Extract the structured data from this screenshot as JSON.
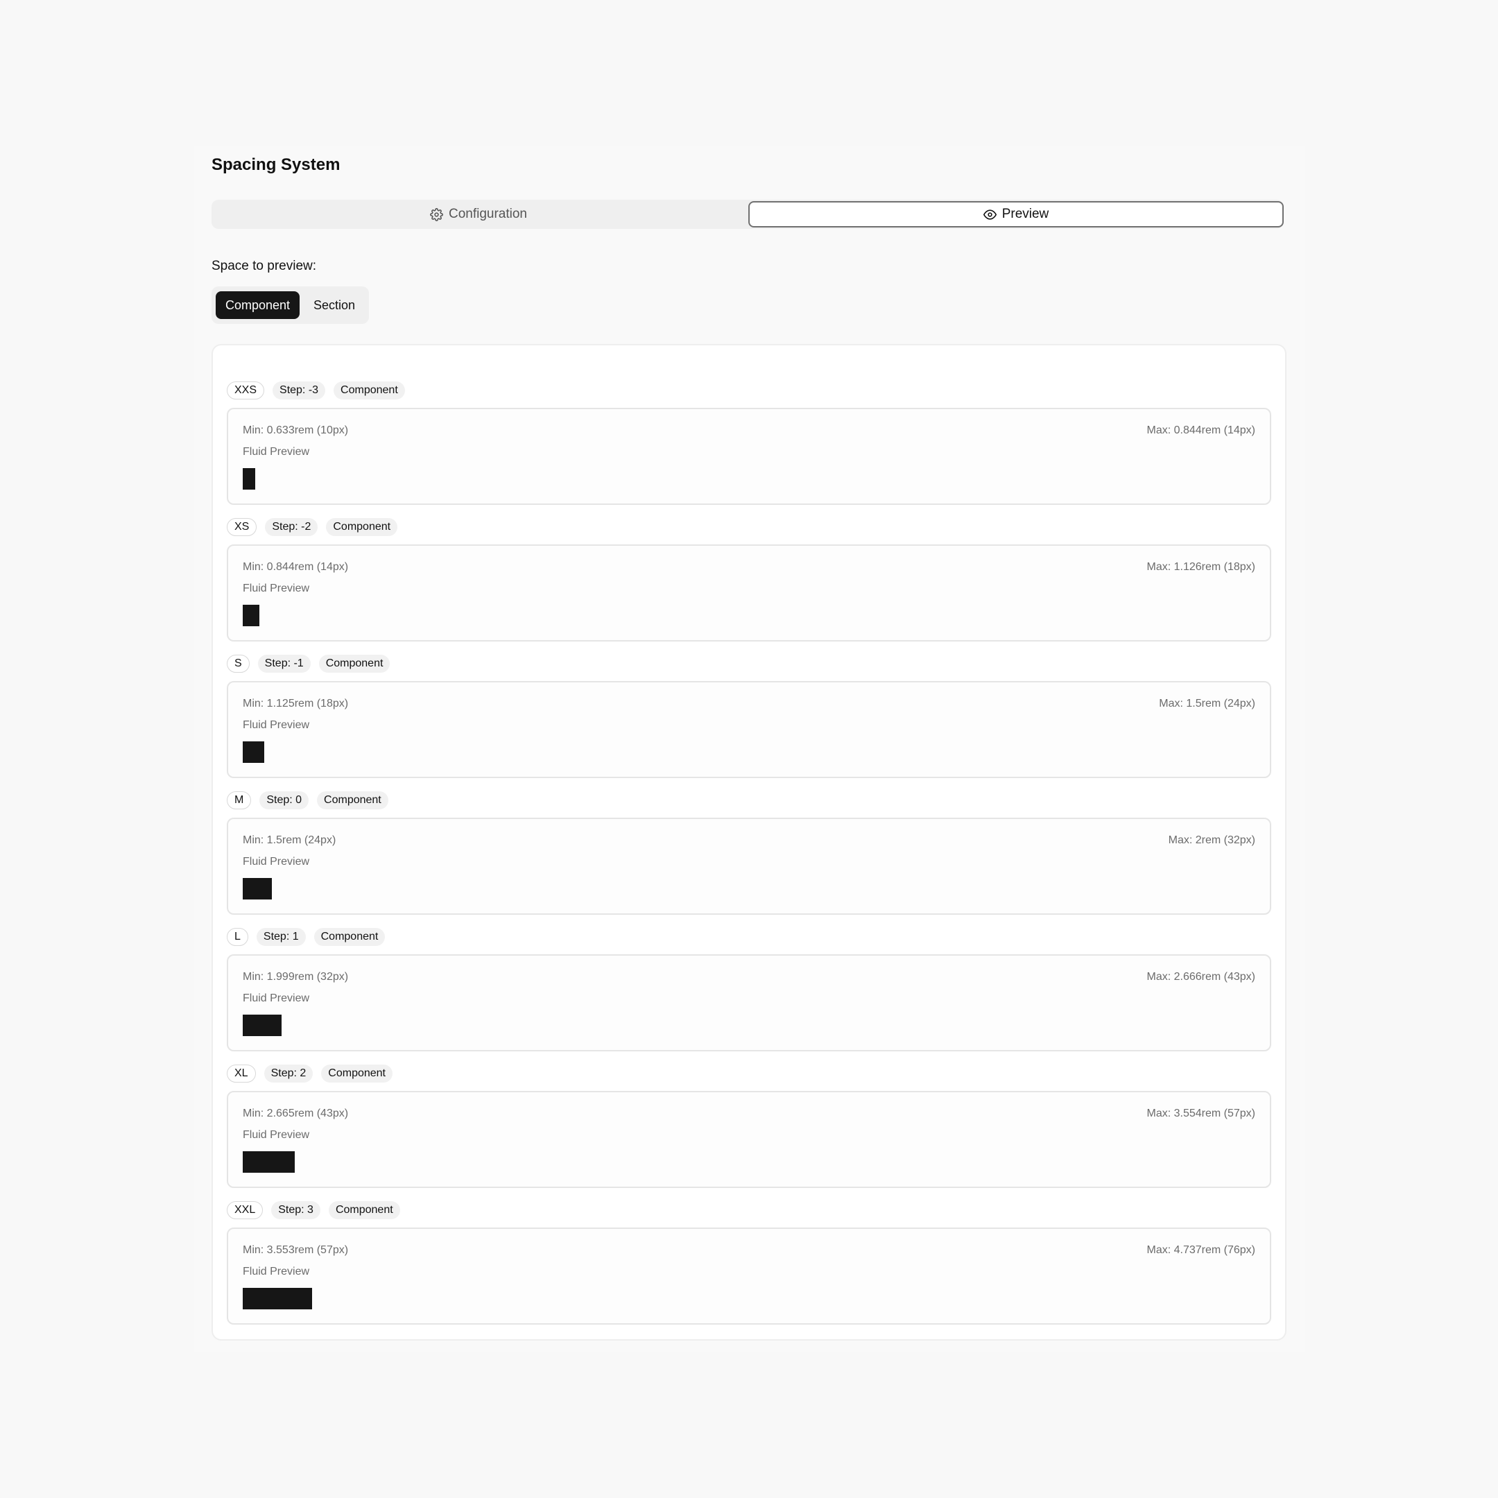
{
  "title": "Spacing System",
  "tabs": [
    {
      "label": "Configuration",
      "icon": "gear-icon"
    },
    {
      "label": "Preview",
      "icon": "eye-icon",
      "active": true
    }
  ],
  "space_label": "Space to preview:",
  "segment": {
    "options": [
      "Component",
      "Section"
    ],
    "selected": "Component"
  },
  "fluid_label": "Fluid Preview",
  "colors": {
    "accent": "#161616",
    "background": "#f8f8f8"
  },
  "steps": [
    {
      "name": "XXS",
      "step": "Step: -3",
      "type": "Component",
      "min": "Min: 0.633rem (10px)",
      "max": "Max: 0.844rem (14px)"
    },
    {
      "name": "XS",
      "step": "Step: -2",
      "type": "Component",
      "min": "Min: 0.844rem (14px)",
      "max": "Max: 1.126rem (18px)"
    },
    {
      "name": "S",
      "step": "Step: -1",
      "type": "Component",
      "min": "Min: 1.125rem (18px)",
      "max": "Max: 1.5rem (24px)"
    },
    {
      "name": "M",
      "step": "Step: 0",
      "type": "Component",
      "min": "Min: 1.5rem (24px)",
      "max": "Max: 2rem (32px)"
    },
    {
      "name": "L",
      "step": "Step: 1",
      "type": "Component",
      "min": "Min: 1.999rem (32px)",
      "max": "Max: 2.666rem (43px)"
    },
    {
      "name": "XL",
      "step": "Step: 2",
      "type": "Component",
      "min": "Min: 2.665rem (43px)",
      "max": "Max: 3.554rem (57px)"
    },
    {
      "name": "XXL",
      "step": "Step: 3",
      "type": "Component",
      "min": "Min: 3.553rem (57px)",
      "max": "Max: 4.737rem (76px)"
    }
  ]
}
